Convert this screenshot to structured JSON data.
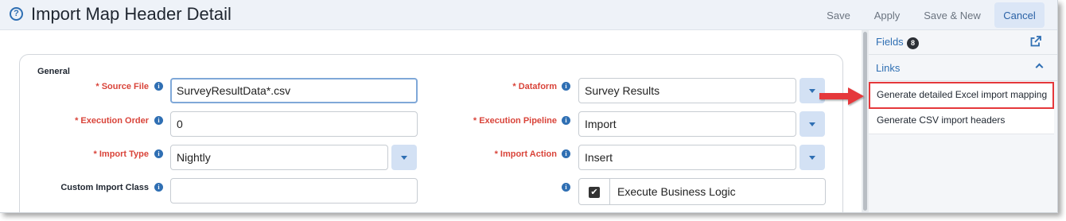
{
  "header": {
    "title": "Import Map Header Detail",
    "help_icon": "?",
    "buttons": {
      "save": "Save",
      "apply": "Apply",
      "save_new": "Save & New",
      "cancel": "Cancel"
    }
  },
  "form": {
    "section_title": "General",
    "source_file": {
      "label": "* Source File",
      "value": "SurveyResultData*.csv"
    },
    "execution_order": {
      "label": "* Execution Order",
      "value": "0"
    },
    "import_type": {
      "label": "* Import Type",
      "value": "Nightly"
    },
    "custom_import_class": {
      "label": "Custom Import Class",
      "value": ""
    },
    "dataform": {
      "label": "* Dataform",
      "value": "Survey Results"
    },
    "execution_pipeline": {
      "label": "* Execution Pipeline",
      "value": "Import"
    },
    "import_action": {
      "label": "* Import Action",
      "value": "Insert"
    },
    "execute_business_logic": {
      "label": "Execute Business Logic",
      "checked": true
    }
  },
  "info_icon_glyph": "i",
  "checkbox_glyph": "✔",
  "sidebar": {
    "fields": {
      "label": "Fields",
      "count": "8"
    },
    "links": {
      "label": "Links",
      "items": [
        "Generate detailed Excel import mapping",
        "Generate CSV import headers"
      ]
    }
  },
  "colors": {
    "accent": "#2f6fb3",
    "required": "#d9443a",
    "highlight": "#e5383b"
  }
}
